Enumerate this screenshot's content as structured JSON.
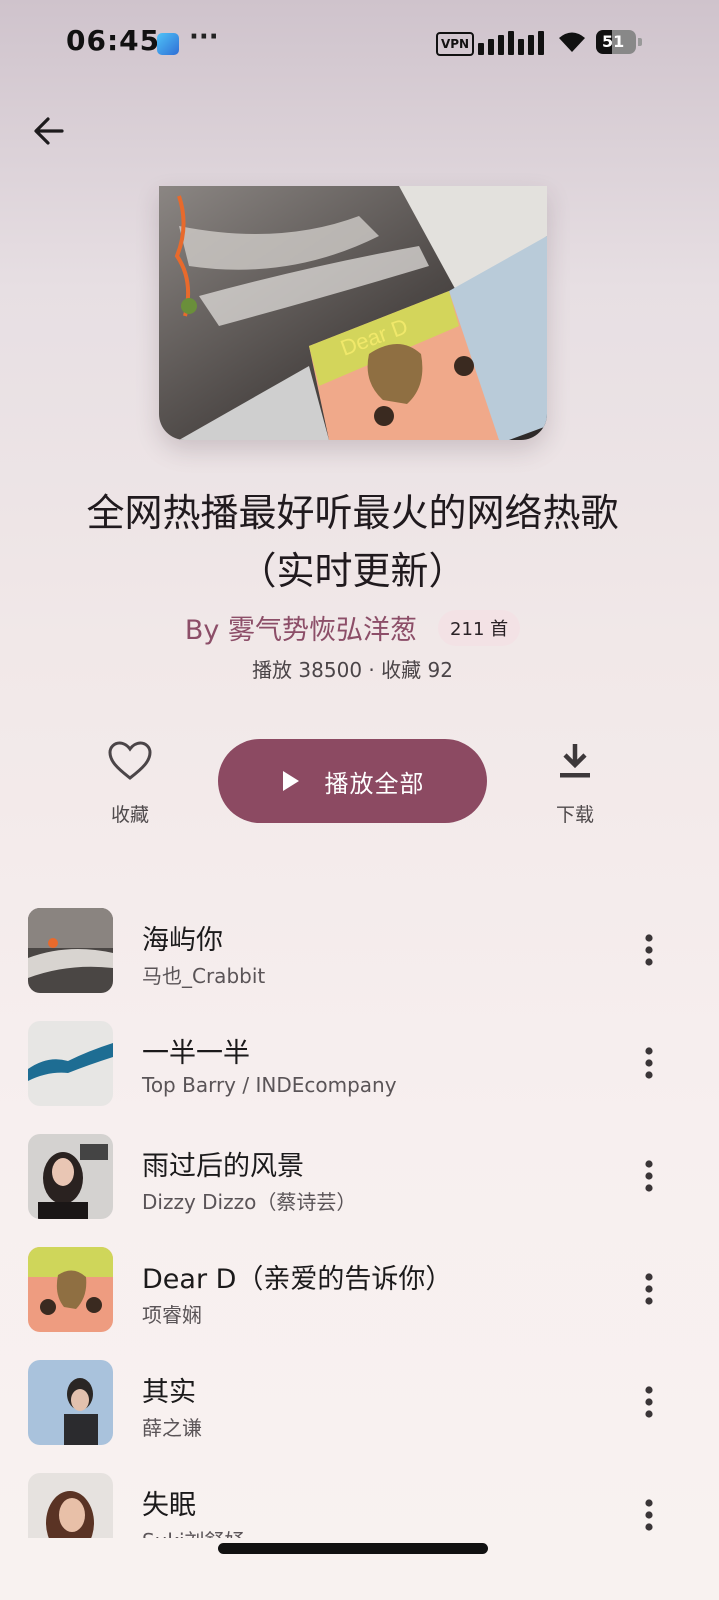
{
  "status_bar": {
    "time": "06:45",
    "vpn_label": "VPN",
    "battery_level": "51",
    "icons": [
      "app-notification-icon",
      "more-dots-icon",
      "vpn-icon",
      "signal-icon",
      "wifi-icon",
      "battery-icon"
    ]
  },
  "header": {
    "back_icon": "arrow-left-icon"
  },
  "playlist": {
    "title_line1": "全网热播最好听最火的网络热歌",
    "title_line2": "（实时更新）",
    "owner": "By 雾气势恢弘洋葱",
    "song_count": "211 首",
    "stats": "播放 38500 · 收藏 92"
  },
  "actions": {
    "favorite_label": "收藏",
    "favorite_icon": "heart-outline-icon",
    "play_all_label": "播放全部",
    "play_icon": "play-icon",
    "download_label": "下载",
    "download_icon": "download-icon"
  },
  "songs": [
    {
      "title": "海屿你",
      "artist": "马也_Crabbit"
    },
    {
      "title": "一半一半",
      "artist": "Top Barry / INDEcompany"
    },
    {
      "title": "雨过后的风景",
      "artist": "Dizzy Dizzo（蔡诗芸）"
    },
    {
      "title": "Dear D（亲爱的告诉你）",
      "artist": "项睿娴"
    },
    {
      "title": "其实",
      "artist": "薛之谦"
    },
    {
      "title": "失眠",
      "artist": "Suki刘舒妤"
    }
  ],
  "colors": {
    "accent": "#8c4a62",
    "owner_text": "#8c4e68",
    "badge_bg": "#f3e2e5"
  }
}
